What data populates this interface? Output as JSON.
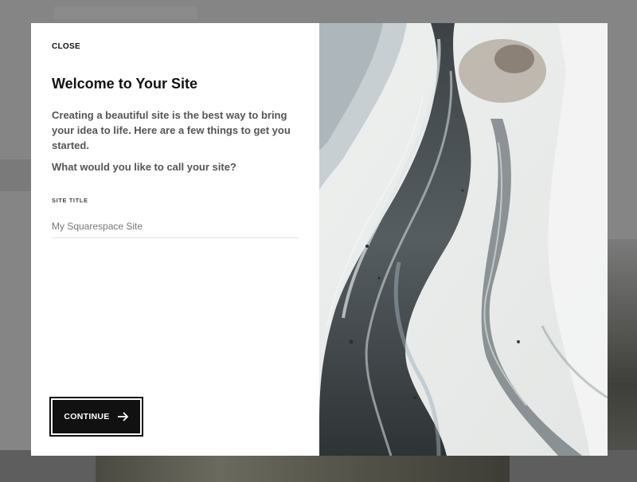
{
  "modal": {
    "close_label": "CLOSE",
    "title": "Welcome to Your Site",
    "intro": "Creating a beautiful site is the best way to bring your idea to life. Here are a few things to get you started.",
    "question": "What would you like to call your site?",
    "site_title_label": "SITE TITLE",
    "site_title_placeholder": "My Squarespace Site",
    "continue_label": "CONTINUE",
    "continue_icon": "arrow-right-icon"
  },
  "colors": {
    "button_bg": "#111111",
    "button_text": "#ffffff",
    "overlay": "#858585"
  }
}
